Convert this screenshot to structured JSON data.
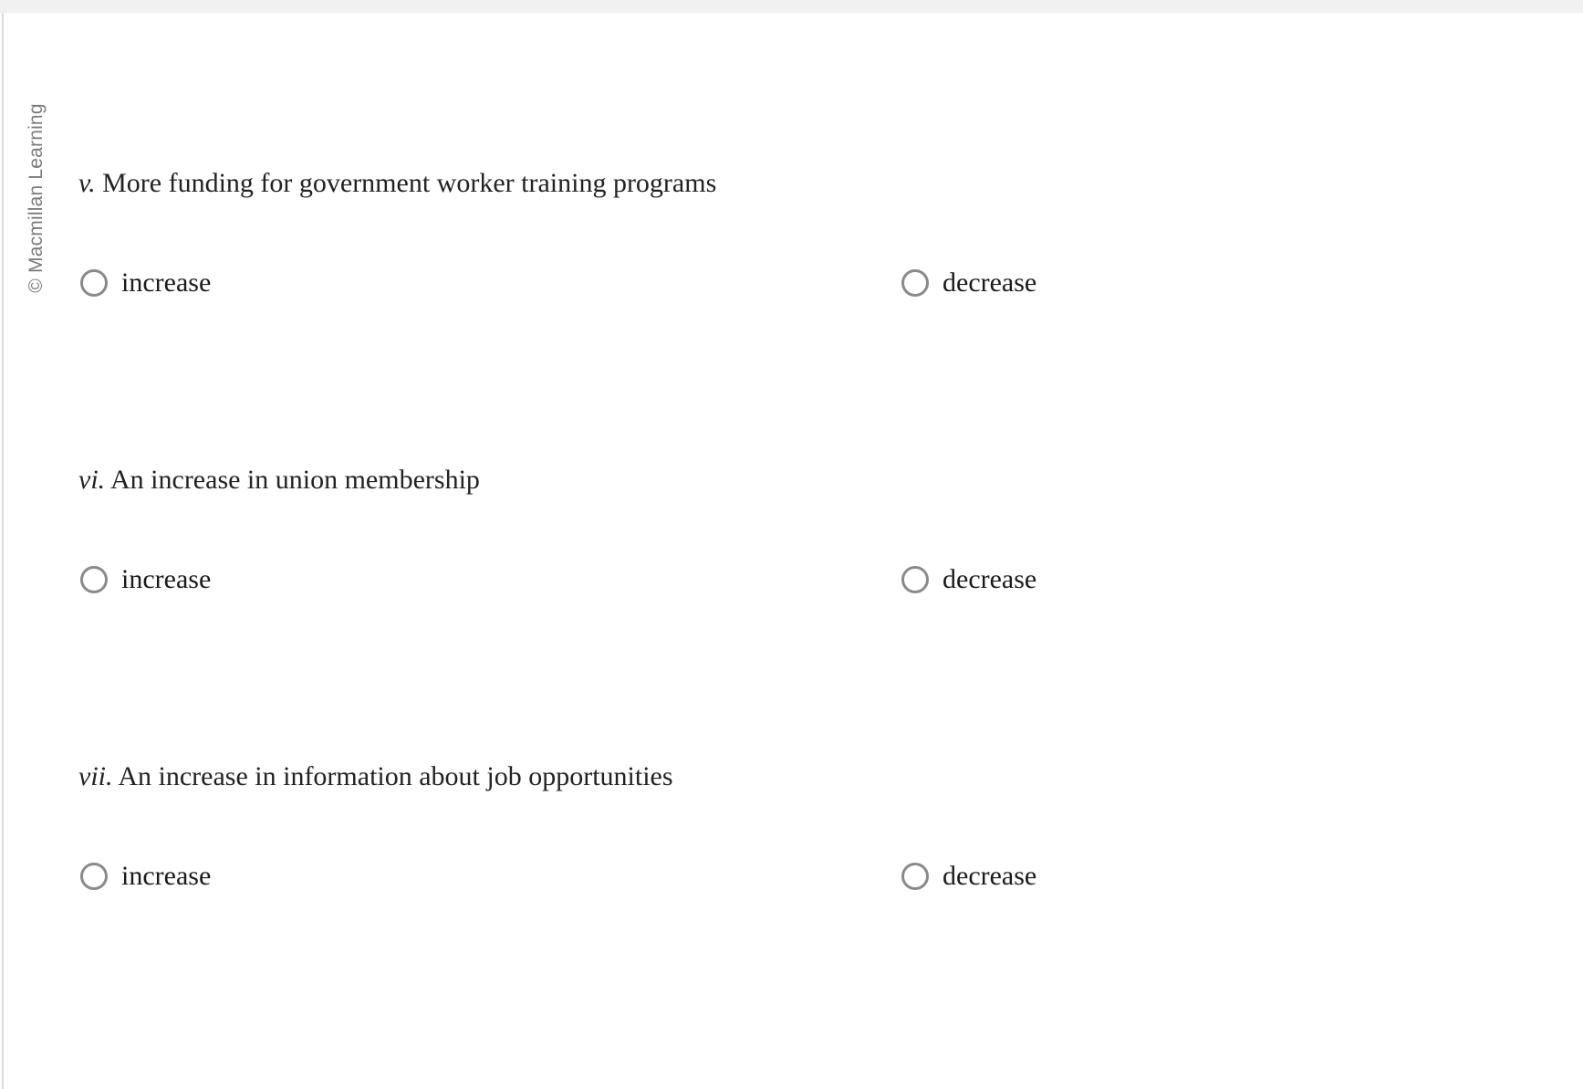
{
  "credit": {
    "text": "© Macmillan Learning"
  },
  "colors": {
    "top_band": "#f1f1f1",
    "left_rule": "#dcdcdc",
    "credit_text": "#7b7b7b",
    "question_text": "#222222",
    "option_text": "#1a1a1a",
    "radio_outline": "#8a8a8a",
    "page_background": "#ffffff"
  },
  "options": {
    "increase_label": "increase",
    "decrease_label": "decrease"
  },
  "questions": [
    {
      "numeral": "v.",
      "prompt": " More funding for government worker training programs",
      "increase_label": "increase",
      "decrease_label": "decrease",
      "selected": ""
    },
    {
      "numeral": "vi.",
      "prompt": " An increase in union membership",
      "increase_label": "increase",
      "decrease_label": "decrease",
      "selected": ""
    },
    {
      "numeral": "vii.",
      "prompt": " An increase in information about job opportunities",
      "increase_label": "increase",
      "decrease_label": "decrease",
      "selected": ""
    }
  ]
}
